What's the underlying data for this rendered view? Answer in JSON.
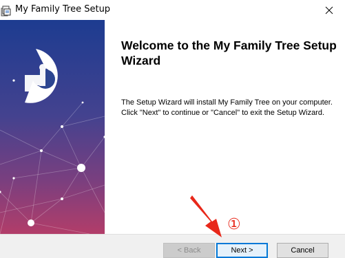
{
  "window": {
    "title": "My Family Tree Setup",
    "app_icon": "installer-icon",
    "close_icon": "close-icon"
  },
  "banner": {
    "logo_icon": "family-tree-logo",
    "gradient_top": "#1e3f8f",
    "gradient_bottom": "#a63a6e"
  },
  "content": {
    "heading": "Welcome to the My Family Tree Setup Wizard",
    "body": "The Setup Wizard will install My Family Tree on your computer.  Click \"Next\" to continue or \"Cancel\" to exit the Setup Wizard."
  },
  "footer": {
    "back_label": "< Back",
    "next_label": "Next >",
    "cancel_label": "Cancel",
    "back_enabled": false
  },
  "annotation": {
    "step_marker": "①",
    "arrow_icon": "red-arrow-icon",
    "color": "#e8281a"
  }
}
